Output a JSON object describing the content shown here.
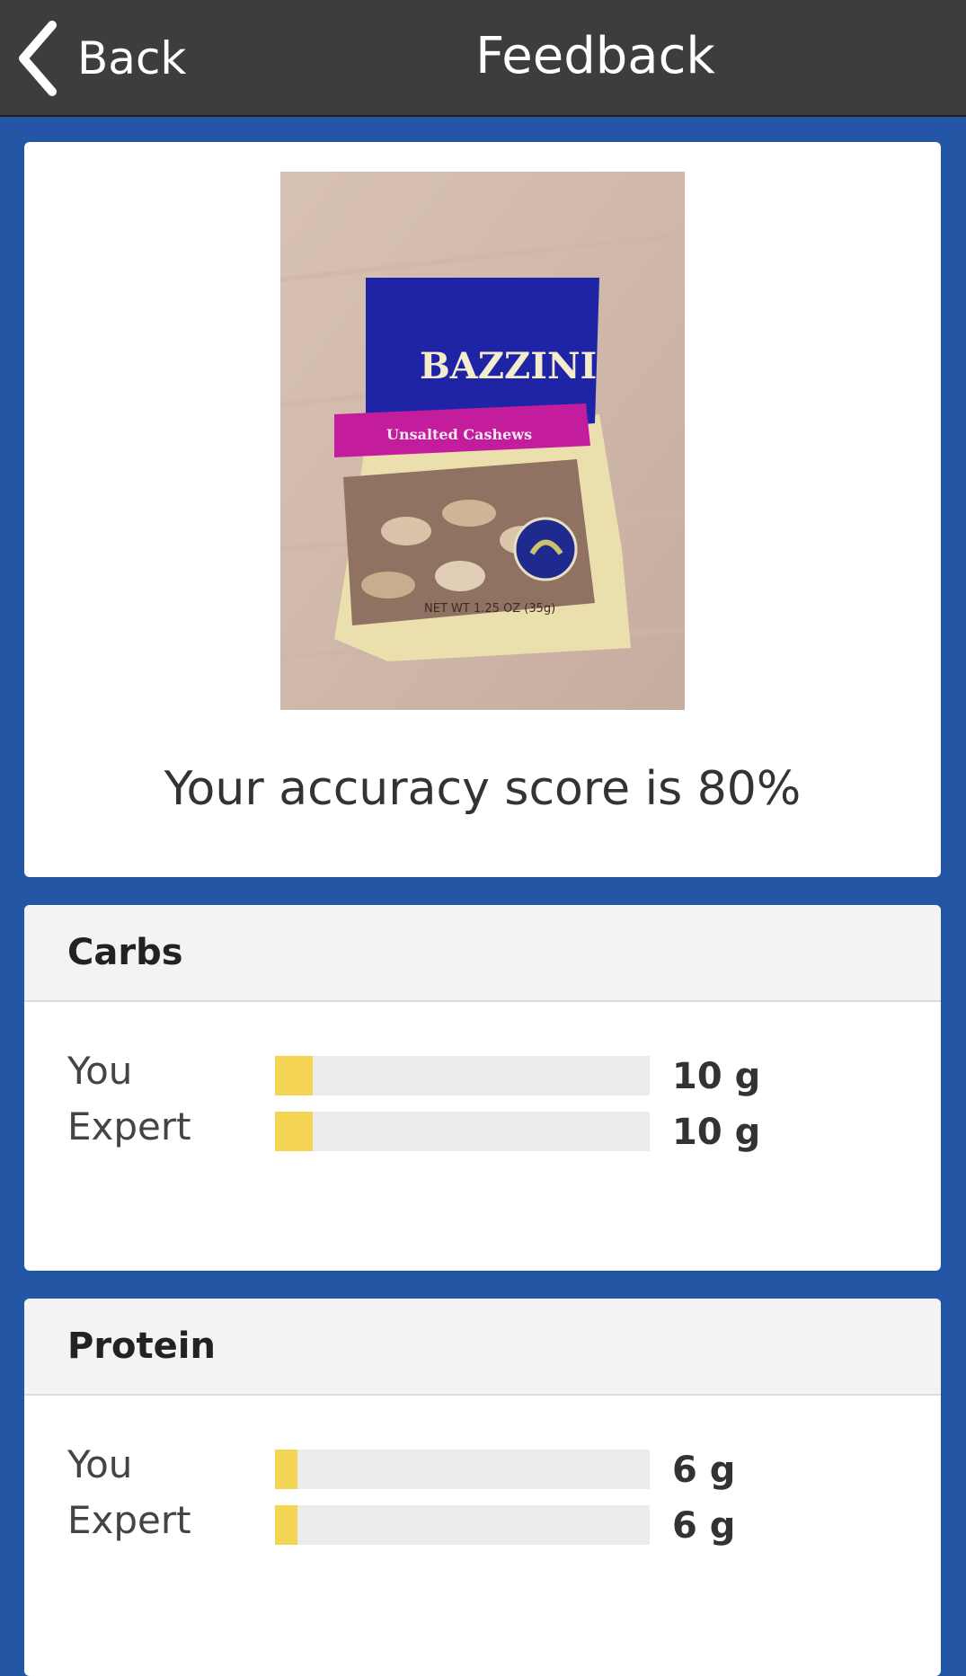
{
  "header": {
    "back_label": "Back",
    "title": "Feedback"
  },
  "photo": {
    "brand_text": "BAZZINI",
    "product_text": "Unsalted Cashews",
    "weight_text": "NET WT 1.25 OZ (35g)"
  },
  "score_text": "Your accuracy score is 80%",
  "sections": [
    {
      "title": "Carbs",
      "rows": [
        {
          "label": "You",
          "value": "10 g",
          "fill_percent": 10
        },
        {
          "label": "Expert",
          "value": "10 g",
          "fill_percent": 10
        }
      ]
    },
    {
      "title": "Protein",
      "rows": [
        {
          "label": "You",
          "value": "6 g",
          "fill_percent": 6
        },
        {
          "label": "Expert",
          "value": "6 g",
          "fill_percent": 6
        }
      ]
    }
  ],
  "colors": {
    "background": "#2356a5",
    "header": "#3d3d3d",
    "bar_fill": "#f4d553",
    "bar_track": "#ececec"
  }
}
